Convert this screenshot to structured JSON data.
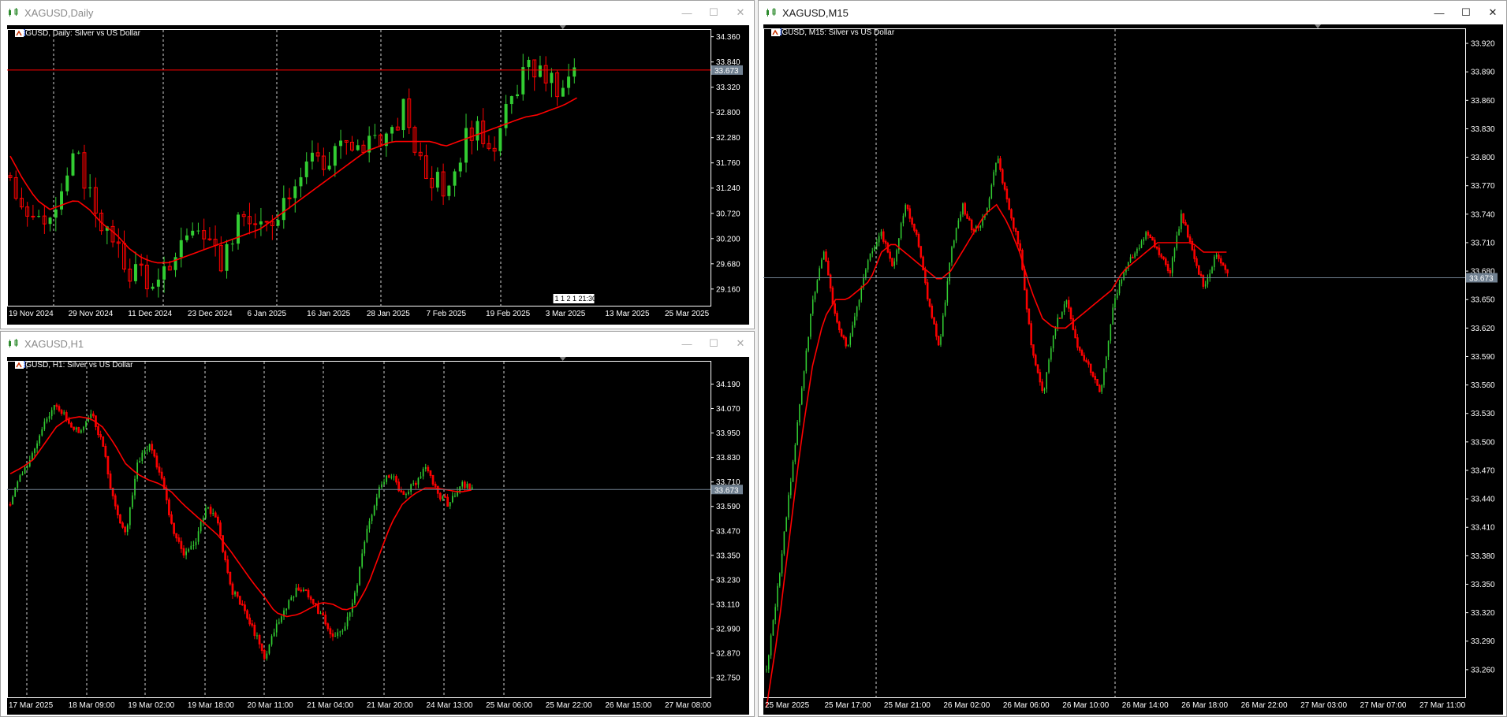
{
  "windows": {
    "daily": {
      "title": "XAGUSD,Daily",
      "chart_title": "XAGUSD, Daily:  Silver vs US Dollar",
      "price_label": "33.673",
      "countdown": "1 1 2 1 21:30"
    },
    "h1": {
      "title": "XAGUSD,H1",
      "chart_title": "XAGUSD, H1:  Silver vs US Dollar",
      "price_label": "33.673"
    },
    "m15": {
      "title": "XAGUSD,M15",
      "chart_title": "XAGUSD, M15:  Silver vs US Dollar",
      "price_label": "33.673"
    }
  },
  "buttons": {
    "minimize": "—",
    "maximize": "☐",
    "close": "✕"
  },
  "colors": {
    "bull": "#32cd32",
    "bear": "#ff0000",
    "ma": "#ff0000",
    "bg": "#000000",
    "price_line": "#708090"
  },
  "chart_data": [
    {
      "type": "candlestick",
      "name": "daily",
      "x": [
        "19 Nov 2024",
        "29 Nov 2024",
        "11 Dec 2024",
        "23 Dec 2024",
        "6 Jan 2025",
        "16 Jan 2025",
        "28 Jan 2025",
        "7 Feb 2025",
        "19 Feb 2025",
        "3 Mar 2025",
        "13 Mar 2025",
        "25 Mar 2025"
      ],
      "y_ticks": [
        "34.360",
        "33.840",
        "33.320",
        "32.800",
        "32.280",
        "31.760",
        "31.240",
        "30.720",
        "30.200",
        "29.680",
        "29.160"
      ],
      "ylim": [
        28.8,
        34.5
      ],
      "current_price": 33.673,
      "close_path": [
        31.5,
        30.9,
        30.4,
        30.8,
        31.3,
        31.9,
        31.2,
        30.5,
        30.0,
        29.5,
        29.6,
        29.0,
        29.6,
        30.1,
        30.5,
        30.0,
        29.7,
        30.3,
        30.7,
        30.3,
        30.6,
        31.1,
        31.6,
        32.0,
        31.6,
        32.3,
        31.9,
        32.1,
        32.4,
        32.2,
        32.9,
        32.0,
        31.5,
        31.2,
        31.7,
        32.5,
        32.3,
        32.2,
        32.9,
        33.6,
        33.7,
        33.5,
        33.1,
        33.7
      ],
      "ma_path": [
        31.9,
        31.4,
        31.0,
        30.8,
        30.9,
        31.0,
        30.8,
        30.5,
        30.3,
        30.0,
        29.8,
        29.7,
        29.7,
        29.8,
        29.9,
        30.0,
        30.1,
        30.2,
        30.3,
        30.4,
        30.6,
        30.8,
        31.0,
        31.2,
        31.4,
        31.6,
        31.8,
        32.0,
        32.1,
        32.2,
        32.2,
        32.2,
        32.2,
        32.1,
        32.2,
        32.3,
        32.4,
        32.5,
        32.6,
        32.7,
        32.75,
        32.85,
        32.95,
        33.1
      ]
    },
    {
      "type": "candlestick",
      "name": "h1",
      "x": [
        "17 Mar 2025",
        "18 Mar 09:00",
        "19 Mar 02:00",
        "19 Mar 18:00",
        "20 Mar 11:00",
        "21 Mar 04:00",
        "21 Mar 20:00",
        "24 Mar 13:00",
        "25 Mar 06:00",
        "25 Mar 22:00",
        "26 Mar 15:00",
        "27 Mar 08:00"
      ],
      "y_ticks": [
        "34.190",
        "34.070",
        "33.950",
        "33.830",
        "33.710",
        "33.590",
        "33.470",
        "33.350",
        "33.230",
        "33.110",
        "32.990",
        "32.870",
        "32.750"
      ],
      "ylim": [
        32.65,
        34.3
      ],
      "current_price": 33.673,
      "close_path": [
        33.6,
        33.75,
        33.85,
        34.0,
        34.1,
        34.0,
        33.95,
        34.05,
        33.9,
        33.6,
        33.45,
        33.8,
        33.9,
        33.75,
        33.5,
        33.35,
        33.4,
        33.6,
        33.5,
        33.2,
        33.1,
        33.0,
        32.85,
        33.0,
        33.1,
        33.2,
        33.15,
        33.05,
        32.95,
        33.0,
        33.2,
        33.5,
        33.7,
        33.75,
        33.65,
        33.7,
        33.8,
        33.65,
        33.6,
        33.7,
        33.68
      ],
      "ma_path": [
        33.75,
        33.78,
        33.82,
        33.9,
        33.98,
        34.02,
        34.03,
        34.02,
        33.98,
        33.9,
        33.8,
        33.75,
        33.72,
        33.7,
        33.66,
        33.6,
        33.55,
        33.5,
        33.45,
        33.38,
        33.3,
        33.22,
        33.15,
        33.07,
        33.05,
        33.06,
        33.09,
        33.12,
        33.11,
        33.08,
        33.1,
        33.2,
        33.35,
        33.5,
        33.6,
        33.65,
        33.68,
        33.68,
        33.67,
        33.66,
        33.67
      ]
    },
    {
      "type": "candlestick",
      "name": "m15",
      "x": [
        "25 Mar 2025",
        "25 Mar 17:00",
        "25 Mar 21:00",
        "26 Mar 02:00",
        "26 Mar 06:00",
        "26 Mar 10:00",
        "26 Mar 14:00",
        "26 Mar 18:00",
        "26 Mar 22:00",
        "27 Mar 03:00",
        "27 Mar 07:00",
        "27 Mar 11:00"
      ],
      "y_ticks": [
        "33.920",
        "33.890",
        "33.860",
        "33.830",
        "33.800",
        "33.770",
        "33.740",
        "33.710",
        "33.680",
        "33.650",
        "33.620",
        "33.590",
        "33.560",
        "33.530",
        "33.500",
        "33.470",
        "33.440",
        "33.410",
        "33.380",
        "33.350",
        "33.320",
        "33.290",
        "33.260"
      ],
      "ylim": [
        33.23,
        33.935
      ],
      "current_price": 33.673,
      "close_path": [
        33.26,
        33.35,
        33.45,
        33.55,
        33.65,
        33.7,
        33.63,
        33.6,
        33.65,
        33.7,
        33.72,
        33.68,
        33.75,
        33.72,
        33.65,
        33.6,
        33.7,
        33.75,
        33.72,
        33.74,
        33.8,
        33.75,
        33.7,
        33.6,
        33.55,
        33.62,
        33.65,
        33.6,
        33.58,
        33.55,
        33.64,
        33.68,
        33.7,
        33.72,
        33.7,
        33.68,
        33.74,
        33.7,
        33.66,
        33.7,
        33.68
      ],
      "ma_path": [
        33.22,
        33.3,
        33.4,
        33.5,
        33.58,
        33.63,
        33.65,
        33.65,
        33.66,
        33.67,
        33.7,
        33.71,
        33.7,
        33.69,
        33.68,
        33.67,
        33.68,
        33.7,
        33.72,
        33.74,
        33.75,
        33.73,
        33.7,
        33.66,
        33.63,
        33.62,
        33.62,
        33.63,
        33.64,
        33.65,
        33.66,
        33.68,
        33.69,
        33.7,
        33.71,
        33.71,
        33.71,
        33.71,
        33.7,
        33.7,
        33.7
      ]
    }
  ]
}
